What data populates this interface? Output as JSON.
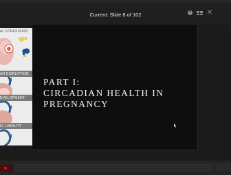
{
  "header": {
    "slide_counter": "Current: Slide 8 of 102",
    "controls": [
      {
        "icon": "help-icon",
        "glyph": "?"
      },
      {
        "icon": "layout-grid-icon"
      },
      {
        "icon": "close-icon",
        "glyph": "✕"
      }
    ]
  },
  "slide": {
    "title_lines": [
      "PART I:",
      "CIRCADIAN HEALTH IN",
      "PREGNANCY"
    ]
  },
  "thumbnail": {
    "labels": [
      "AL STRESSORS",
      "AN DISRUPTION",
      "EVELOPMENT",
      "IC LIABILITY"
    ]
  },
  "colors": {
    "slide_background": "#0e0e0e",
    "title_text": "#f4f4f4",
    "record_accent": "#d11a1a"
  }
}
